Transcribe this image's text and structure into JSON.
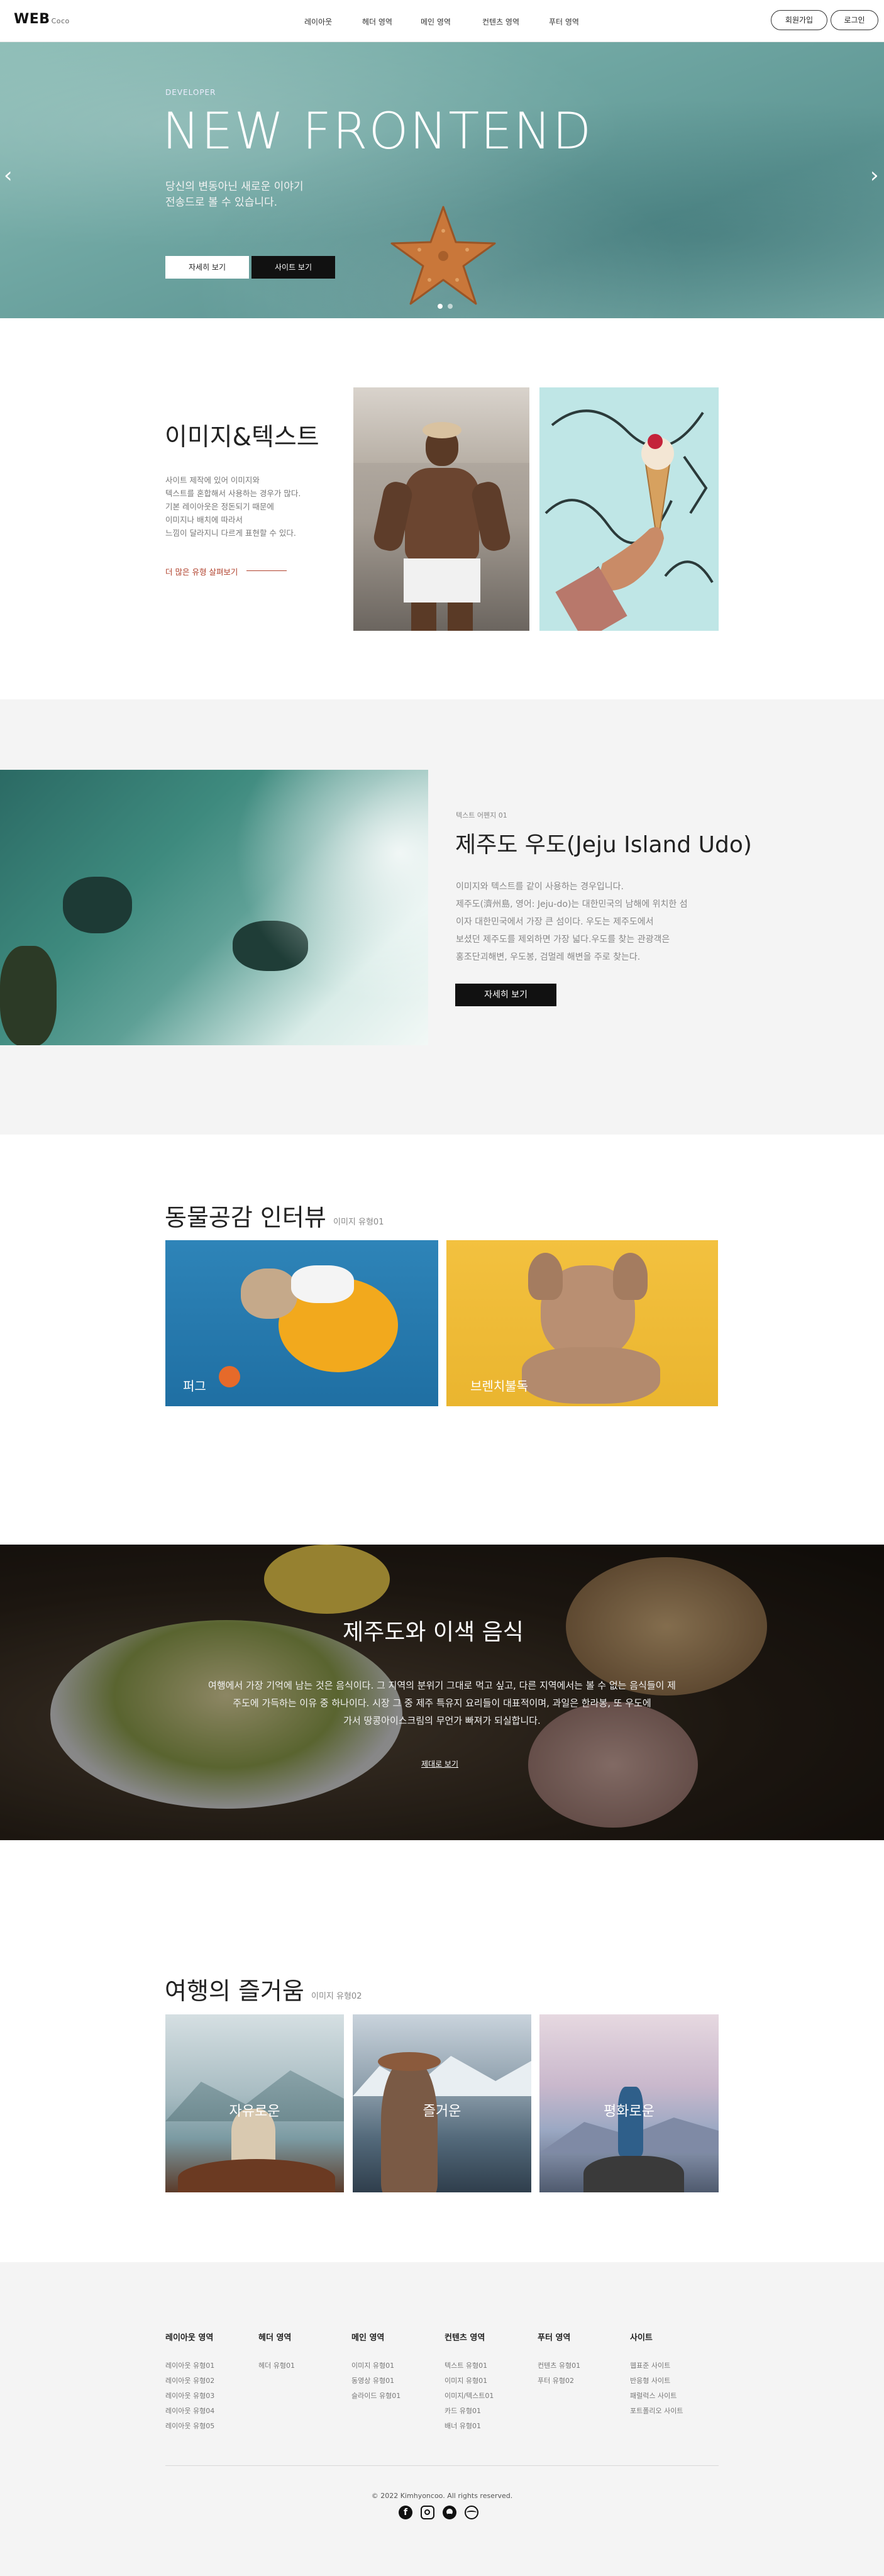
{
  "header": {
    "logo": "WEB",
    "logo_sub": "Coco",
    "nav": [
      "레이아웃",
      "헤더 영역",
      "메인 영역",
      "컨텐츠 영역",
      "푸터 영역"
    ],
    "join_label": "회원가입",
    "login_label": "로그인"
  },
  "hero": {
    "eyebrow": "DEVELOPER",
    "title": "NEW FRONTEND",
    "desc_line1": "당신의 변동아닌 새로운 이야기",
    "desc_line2": "전송드로 볼 수 있습니다.",
    "btn_detail": "자세히 보기",
    "btn_site": "사이트 보기",
    "prev_arrow": "‹",
    "next_arrow": "›",
    "active_slide": 1,
    "slide_count": 2
  },
  "image_text": {
    "title": "이미지&텍스트",
    "desc": [
      "사이트 제작에 있어 이미지와",
      "텍스트를 혼합해서 사용하는 경우가 많다.",
      "기본 레이아웃은 정돈되기 때문에",
      "이미지나 배치에 따라서",
      "느낌이 달라지니 다르게 표현할 수 있다."
    ],
    "link": "더 많은 유형 살펴보기"
  },
  "udo": {
    "label": "텍스트 어펜지 01",
    "title": "제주도 우도(Jeju Island Udo)",
    "desc": [
      "이미지와 텍스트를 같이 사용하는 경우입니다.",
      "제주도(濟州島, 영어: Jeju-do)는 대한민국의 남해에 위치한 섬",
      "이자 대한민국에서 가장 큰 섬이다. 우도는 제주도에서",
      "보셨던 제주도를 제외하면 가장 넓다.우도를 찾는 관광객은",
      "홍조단괴해변, 우도봉, 검멀레 해변을 주로 찾는다."
    ],
    "button": "자세히 보기"
  },
  "animals": {
    "title": "동물공감 인터뷰",
    "subtitle": "이미지 유형01",
    "cards": [
      "퍼그",
      "브렌치불독"
    ]
  },
  "food": {
    "title": "제주도와 이색 음식",
    "desc": [
      "여행에서 가장 기억에 남는 것은 음식이다. 그 지역의 분위기 그대로 먹고 싶고, 다른 지역에서는 볼 수 없는 음식들이 제",
      "주도에 가득하는 이유 중 하나이다. 시장 그 중 제주 특유지 요리들이 대표적이며, 과일은 한라봉, 또 우도에",
      "가서 땅콩아이스크림의 무언가 빠져가 되실합니다."
    ],
    "link": "제대로 보기"
  },
  "travel": {
    "title": "여행의 즐거움",
    "subtitle": "이미지 유형02",
    "cards": [
      "자유로운",
      "즐거운",
      "평화로운"
    ]
  },
  "footer": {
    "columns": [
      {
        "title": "레이아웃 영역",
        "items": [
          "레이아웃 유형01",
          "레이아웃 유형02",
          "레이아웃 유형03",
          "레이아웃 유형04",
          "레이아웃 유형05"
        ]
      },
      {
        "title": "헤더 영역",
        "items": [
          "헤더 유형01"
        ]
      },
      {
        "title": "메인 영역",
        "items": [
          "이미지 유형01",
          "동영상 유형01",
          "슬라이드 유형01"
        ]
      },
      {
        "title": "컨텐츠 영역",
        "items": [
          "텍스트 유형01",
          "이미지 유형01",
          "이미지/텍스트01",
          "카드 유형01",
          "배너 유형01"
        ]
      },
      {
        "title": "푸터 영역",
        "items": [
          "컨텐츠 유형01",
          "푸터 유형02"
        ]
      },
      {
        "title": "사이트",
        "items": [
          "웹표준 사이트",
          "반응형 사이트",
          "패럴럭스 사이트",
          "포트폴리오 사이트"
        ]
      }
    ],
    "copyright": "© 2022 Kimhyoncoo. All rights reserved."
  }
}
